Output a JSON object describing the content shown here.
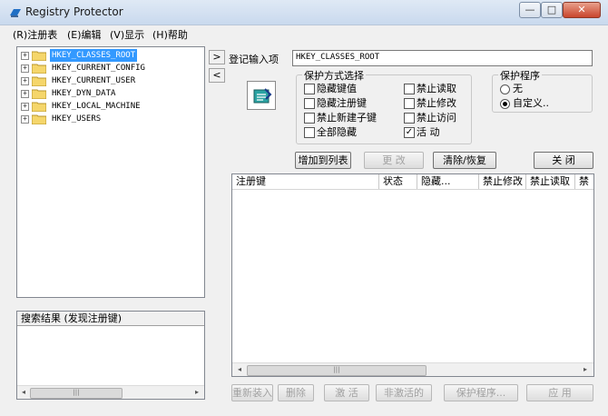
{
  "window": {
    "title": "Registry Protector",
    "minimize_glyph": "—",
    "maximize_glyph": "□",
    "close_glyph": "✕"
  },
  "menu": [
    "(R)注册表",
    "(E)编辑",
    "(V)显示",
    "(H)帮助"
  ],
  "tree": {
    "items": [
      {
        "label": "HKEY_CLASSES_ROOT",
        "selected": true
      },
      {
        "label": "HKEY_CURRENT_CONFIG",
        "selected": false
      },
      {
        "label": "HKEY_CURRENT_USER",
        "selected": false
      },
      {
        "label": "HKEY_DYN_DATA",
        "selected": false
      },
      {
        "label": "HKEY_LOCAL_MACHINE",
        "selected": false
      },
      {
        "label": "HKEY_USERS",
        "selected": false
      }
    ],
    "expander_glyph": "+"
  },
  "search": {
    "header": "搜索结果 (发现注册键)"
  },
  "nav": {
    "forward": ">",
    "back": "<"
  },
  "entry": {
    "label": "登记输入项",
    "value": "HKEY_CLASSES_ROOT"
  },
  "protect_mode": {
    "title": "保护方式选择",
    "options": [
      {
        "label": "隐藏键值",
        "checked": false
      },
      {
        "label": "禁止读取",
        "checked": false
      },
      {
        "label": "隐藏注册键",
        "checked": false
      },
      {
        "label": "禁止修改",
        "checked": false
      },
      {
        "label": "禁止新建子键",
        "checked": false
      },
      {
        "label": "禁止访问",
        "checked": false
      },
      {
        "label": "全部隐藏",
        "checked": false
      },
      {
        "label": "活  动",
        "checked": true
      }
    ]
  },
  "protect_program": {
    "title": "保护程序",
    "options": [
      {
        "label": "无",
        "selected": false
      },
      {
        "label": "自定义..",
        "selected": true
      }
    ]
  },
  "buttons": {
    "add_to_list": "增加到列表",
    "change": "更  改",
    "clear_restore": "清除/恢复",
    "close": "关  闭",
    "reload": "重新装入",
    "delete": "删除",
    "activate": "激  活",
    "deactivate": "非激活的",
    "protect_program": "保护程序...",
    "apply": "应  用"
  },
  "list": {
    "columns": [
      "注册键",
      "状态",
      "隐藏...",
      "禁止修改",
      "禁止读取",
      "禁"
    ]
  },
  "scroll": {
    "left": "◂",
    "right": "▸",
    "grip": "|||"
  },
  "colors": {
    "selection": "#3399ff",
    "titlebar": "#c9d9ee",
    "folder": "#f5d66b"
  }
}
